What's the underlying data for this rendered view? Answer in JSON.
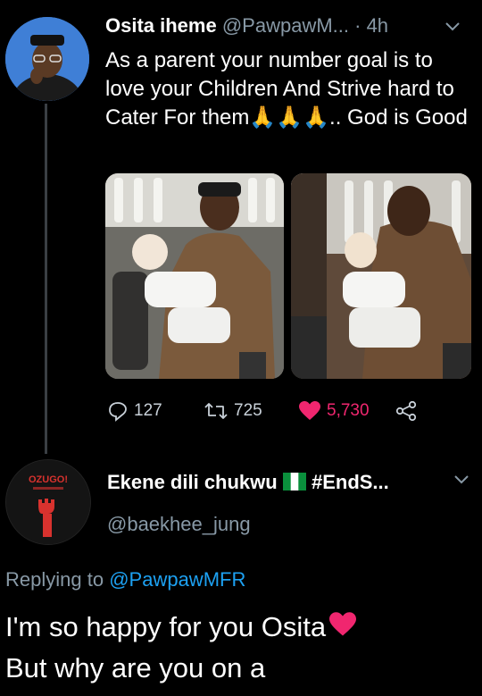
{
  "tweet1": {
    "display_name": "Osita iheme",
    "handle": "@PawpawM...",
    "time": "· 4h",
    "text_before_emoji": "As a parent your number goal is to love your Children And Strive hard to Cater For them",
    "emoji": "🙏🙏🙏",
    "text_after_emoji": ".. God is Good",
    "actions": {
      "reply_count": "127",
      "retweet_count": "725",
      "like_count": "5,730"
    },
    "colors": {
      "like": "#f0266f",
      "muted": "#8899a6"
    }
  },
  "tweet2": {
    "display_name": "Ekene dili chukwu",
    "flag": "🇳🇬",
    "name_suffix": "#EndS...",
    "handle": "@baekhee_jung",
    "avatar_text": "OZUGO!",
    "replying_prefix": "Replying to",
    "replying_handle": "@PawpawMFR",
    "text": "I'm so happy for you Osita",
    "text_emoji": "❤",
    "text_line2": "But why are you on a"
  }
}
